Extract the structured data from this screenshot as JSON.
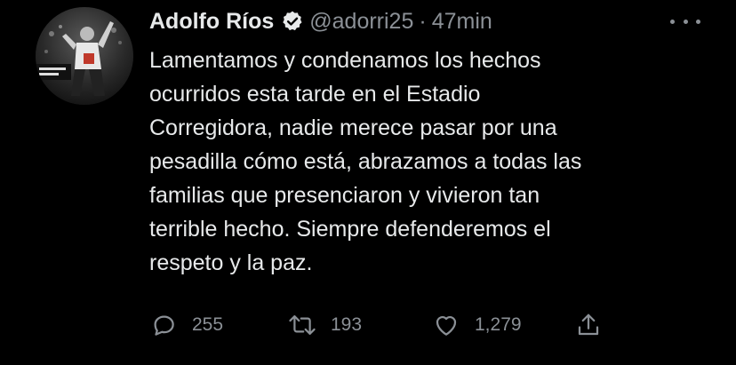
{
  "tweet": {
    "display_name": "Adolfo Ríos",
    "handle": "@adorri25",
    "separator": "·",
    "time": "47min",
    "text": "Lamentamos y condenamos los hechos\nocurridos esta tarde en el Estadio\nCorregidora, nadie merece pasar por una\npesadilla cómo está, abrazamos a todas las\nfamilias que presenciaron y vivieron tan\nterrible hecho. Siempre defenderemos el\nrespeto y la paz.",
    "counts": {
      "replies": "255",
      "retweets": "193",
      "likes": "1,279"
    }
  },
  "icons": {
    "avatar": "profile-photo",
    "verified": "verified-badge-icon",
    "more": "more-options-icon",
    "reply": "reply-icon",
    "retweet": "retweet-icon",
    "like": "heart-icon",
    "share": "share-icon"
  },
  "colors": {
    "background": "#000000",
    "text": "#e7e9ea",
    "secondary": "#8b9096"
  }
}
